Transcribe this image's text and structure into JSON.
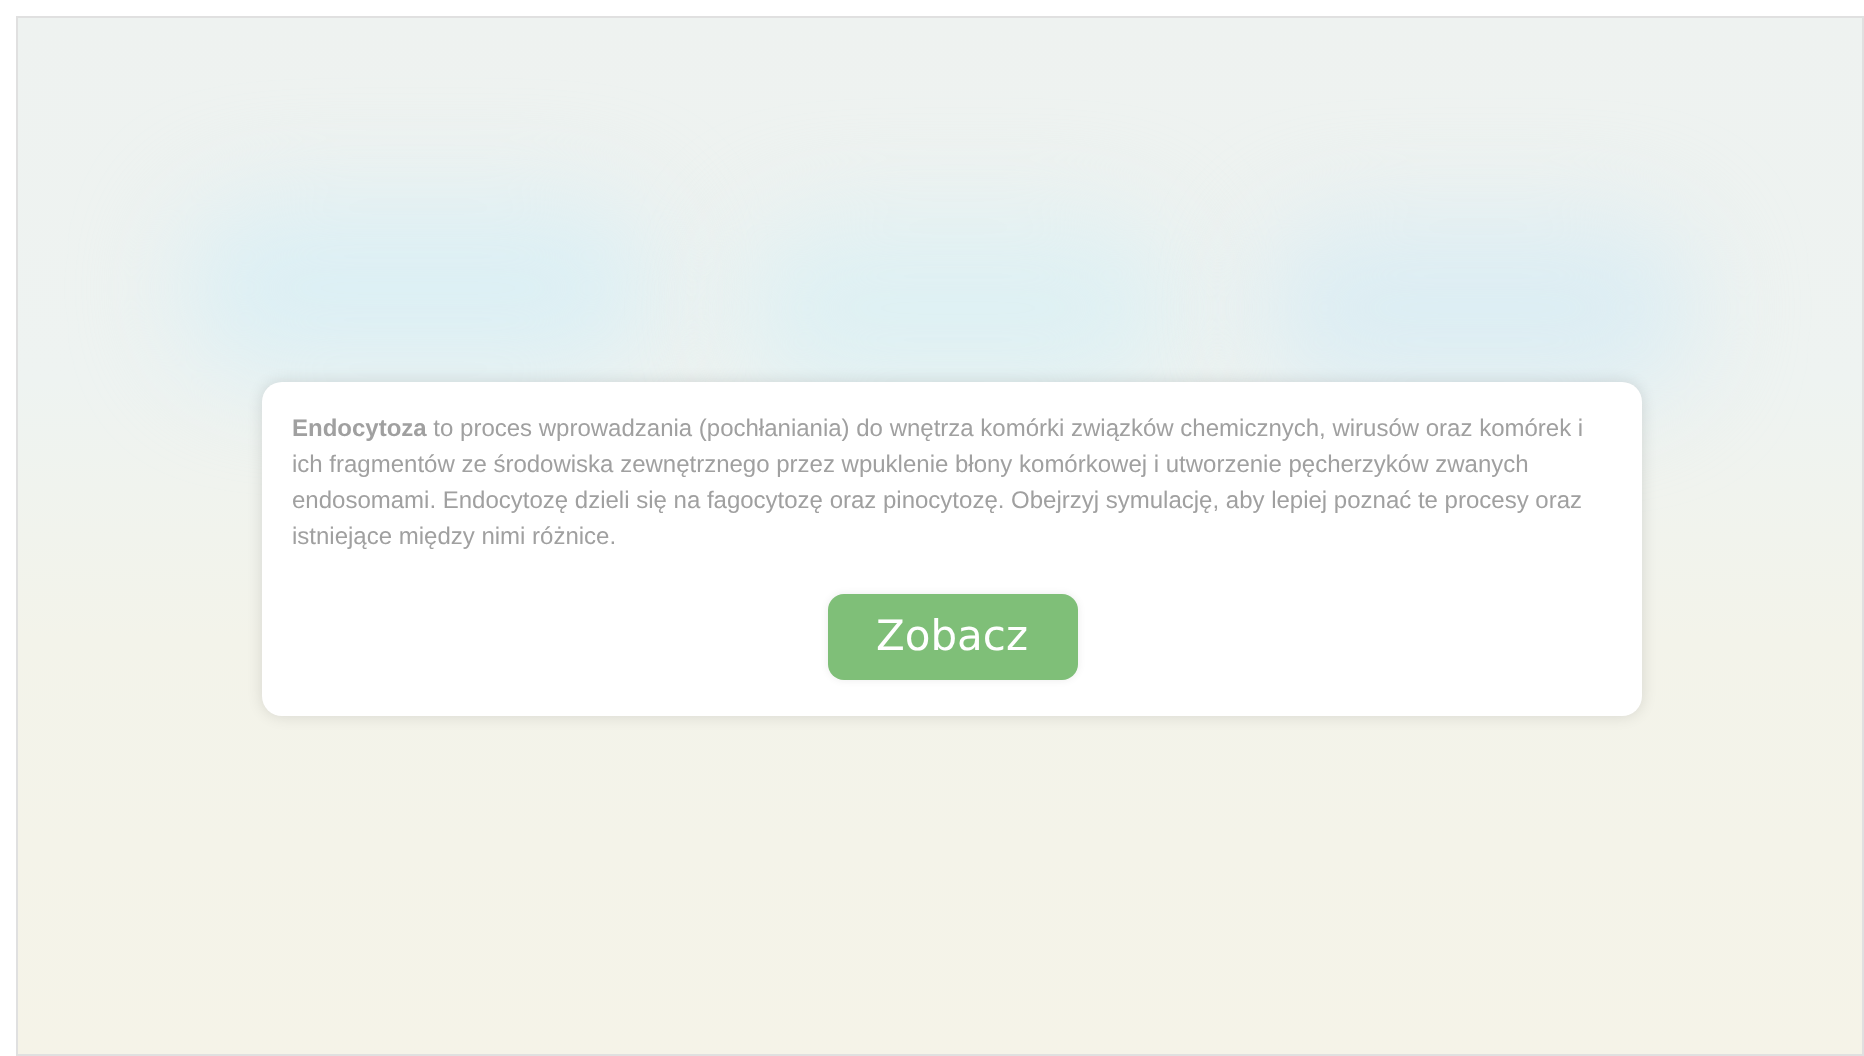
{
  "intro": {
    "text": "**Endocytoza** to proces wprowadzania (pochłaniania) do wnętrza komórki związków chemicznych, wirusów oraz komórek i ich fragmentów ze środowiska zewnętrznego przez wpuklenie błony komórkowej i utworzenie pęcherzyków zwanych endosomami. Endocytozę dzieli się na fagocytozę oraz pinocytozę. Obejrzyj symulację, aby lepiej poznać te procesy oraz istniejące między nimi różnice.",
    "button": "Zobacz"
  }
}
